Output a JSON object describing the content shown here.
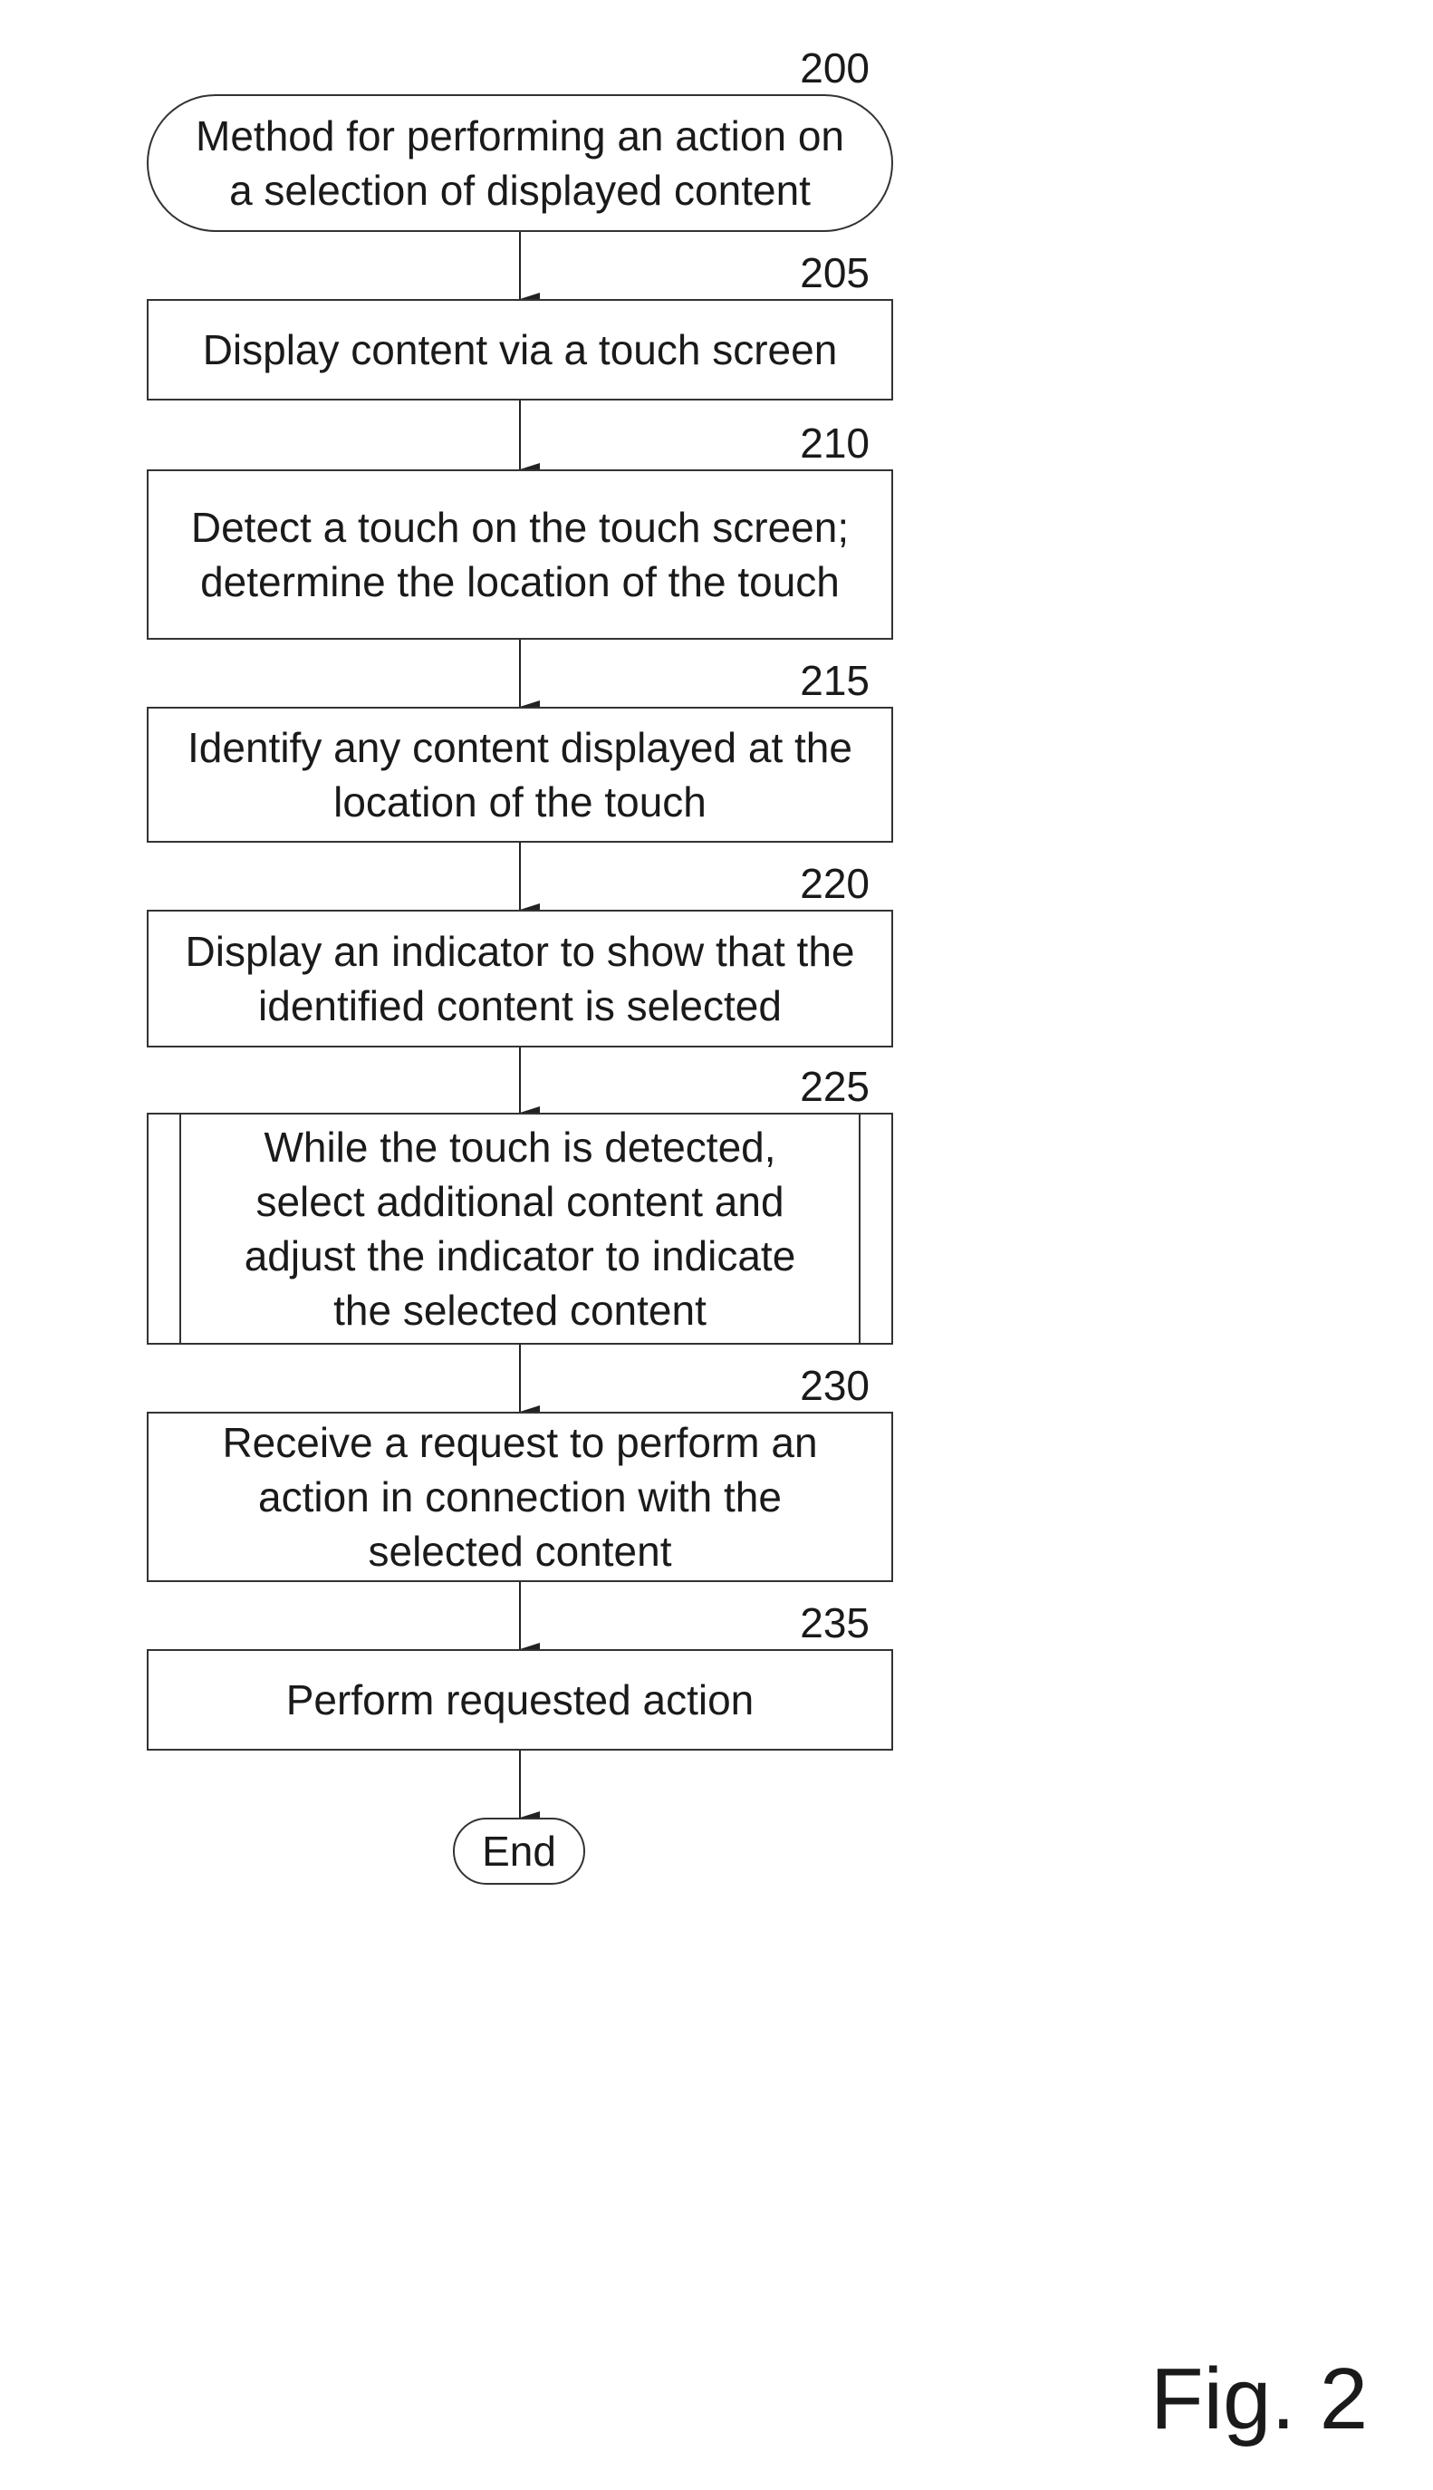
{
  "figure_label": "Fig. 2",
  "steps": [
    {
      "ref": "200",
      "text": "Method for performing an action on\na selection of displayed content",
      "shape": "terminal"
    },
    {
      "ref": "205",
      "text": "Display content via a touch screen",
      "shape": "process"
    },
    {
      "ref": "210",
      "text": "Detect a touch on the touch screen;\ndetermine the location of the touch",
      "shape": "process"
    },
    {
      "ref": "215",
      "text": "Identify any content displayed at the\nlocation of the touch",
      "shape": "process"
    },
    {
      "ref": "220",
      "text": "Display an indicator to show that the\nidentified content is selected",
      "shape": "process"
    },
    {
      "ref": "225",
      "text": "While the touch is detected,\nselect additional content and\nadjust the indicator to indicate\nthe selected content",
      "shape": "subprocess"
    },
    {
      "ref": "230",
      "text": "Receive a request to perform an\naction in connection with the\nselected content",
      "shape": "process"
    },
    {
      "ref": "235",
      "text": "Perform requested action",
      "shape": "process"
    },
    {
      "ref": "",
      "text": "End",
      "shape": "terminal"
    }
  ]
}
